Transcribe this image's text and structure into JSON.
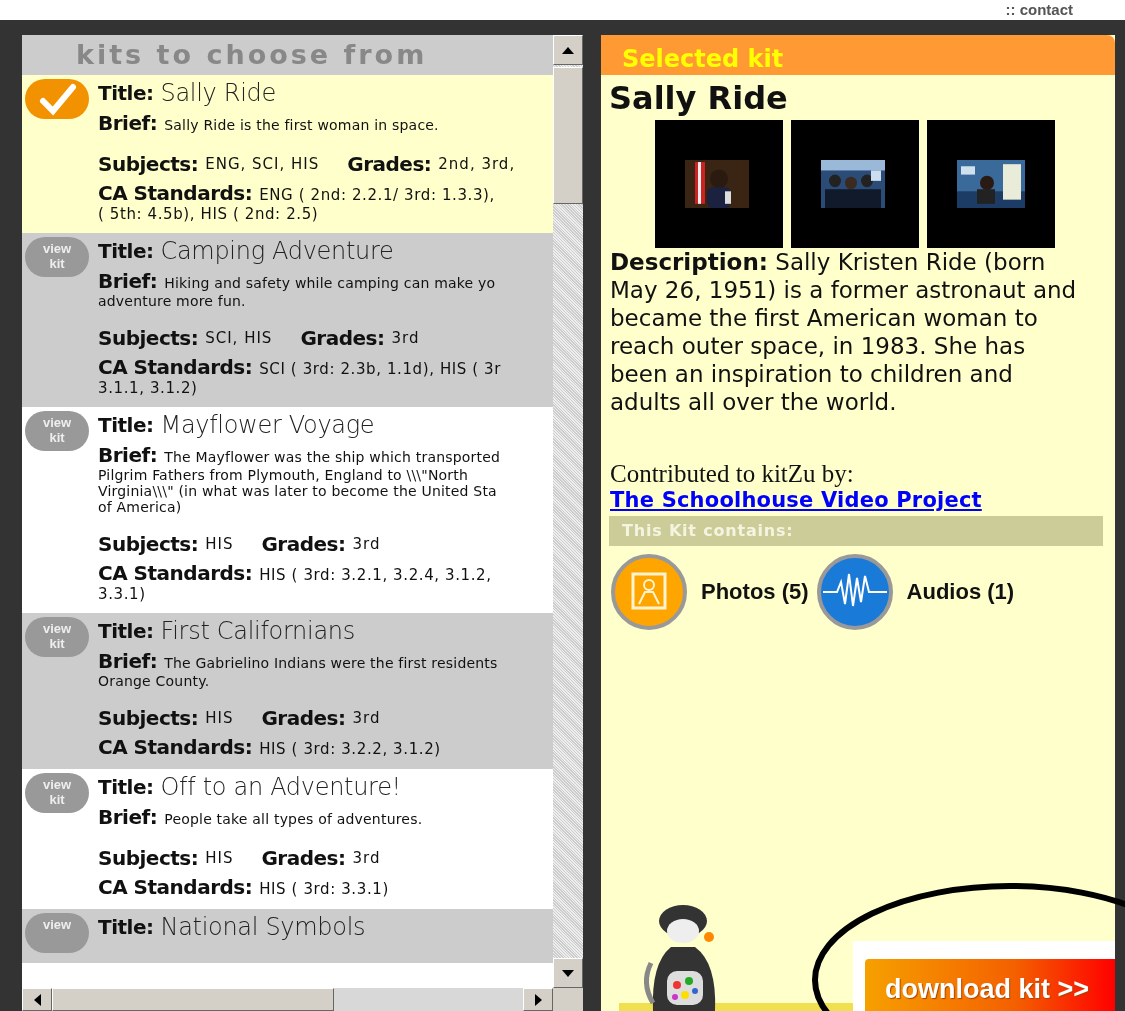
{
  "top_nav": {
    "link": ":: contact"
  },
  "kit_list": {
    "heading": "kits to choose from",
    "items": [
      {
        "selected": true,
        "title_label": "Title:",
        "title": "Sally Ride",
        "brief_label": "Brief:",
        "brief": [
          "Sally Ride is the first woman in space."
        ],
        "subjects_label": "Subjects:",
        "subjects": "ENG, SCI, HIS",
        "grades_label": "Grades:",
        "grades": "2nd, 3rd,",
        "standards_label": "CA Standards:",
        "standards": [
          "ENG ( 2nd: 2.2.1/ 3rd: 1.3.3),",
          "( 5th: 4.5b), HIS ( 2nd: 2.5)"
        ]
      },
      {
        "selected": false,
        "badge": [
          "view",
          "kit"
        ],
        "title_label": "Title:",
        "title": "Camping Adventure",
        "brief_label": "Brief:",
        "brief": [
          "Hiking and safety while camping can make yo",
          "adventure more fun."
        ],
        "subjects_label": "Subjects:",
        "subjects": "SCI, HIS",
        "grades_label": "Grades:",
        "grades": "3rd",
        "standards_label": "CA Standards:",
        "standards": [
          "SCI ( 3rd: 2.3b, 1.1d), HIS ( 3r",
          "3.1.1, 3.1.2)"
        ]
      },
      {
        "selected": false,
        "badge": [
          "view",
          "kit"
        ],
        "title_label": "Title:",
        "title": "Mayflower Voyage",
        "brief_label": "Brief:",
        "brief": [
          "The Mayflower was the ship which transported",
          "Pilgrim Fathers from Plymouth, England to \\\\\\\"North",
          "Virginia\\\\\\\" (in what was later to become the United Sta",
          "of America)"
        ],
        "subjects_label": "Subjects:",
        "subjects": "HIS",
        "grades_label": "Grades:",
        "grades": "3rd",
        "standards_label": "CA Standards:",
        "standards": [
          "HIS ( 3rd: 3.2.1, 3.2.4, 3.1.2,",
          "3.3.1)"
        ]
      },
      {
        "selected": false,
        "badge": [
          "view",
          "kit"
        ],
        "title_label": "Title:",
        "title": "First Californians",
        "brief_label": "Brief:",
        "brief": [
          "The Gabrielino Indians were the first residents",
          "Orange County."
        ],
        "subjects_label": "Subjects:",
        "subjects": "HIS",
        "grades_label": "Grades:",
        "grades": "3rd",
        "standards_label": "CA Standards:",
        "standards": [
          "HIS ( 3rd: 3.2.2, 3.1.2)"
        ]
      },
      {
        "selected": false,
        "badge": [
          "view",
          "kit"
        ],
        "title_label": "Title:",
        "title": "Off to an Adventure!",
        "brief_label": "Brief:",
        "brief": [
          "People take all types of adventures."
        ],
        "subjects_label": "Subjects:",
        "subjects": "HIS",
        "grades_label": "Grades:",
        "grades": "3rd",
        "standards_label": "CA Standards:",
        "standards": [
          "HIS ( 3rd: 3.3.1)"
        ]
      },
      {
        "selected": false,
        "badge": [
          "view"
        ],
        "title_label": "Title:",
        "title": "National Symbols"
      }
    ]
  },
  "selected_kit": {
    "heading": "Selected kit",
    "name": "Sally Ride",
    "description": "**Description:**  Sally Kristen Ride (born May 26, 1951) is a former astronaut and became the first American woman to reach outer space, in 1983. She has been an inspiration to children and adults all over the world.",
    "contributed_label": "Contributed to kitZu by:",
    "contributor": "The Schoolhouse Video Project",
    "contains_heading": "This Kit contains:",
    "media": [
      {
        "kind": "photos",
        "label": "Photos (5)"
      },
      {
        "kind": "audios",
        "label": "Audios (1)"
      }
    ],
    "download_button": "download kit >>"
  }
}
